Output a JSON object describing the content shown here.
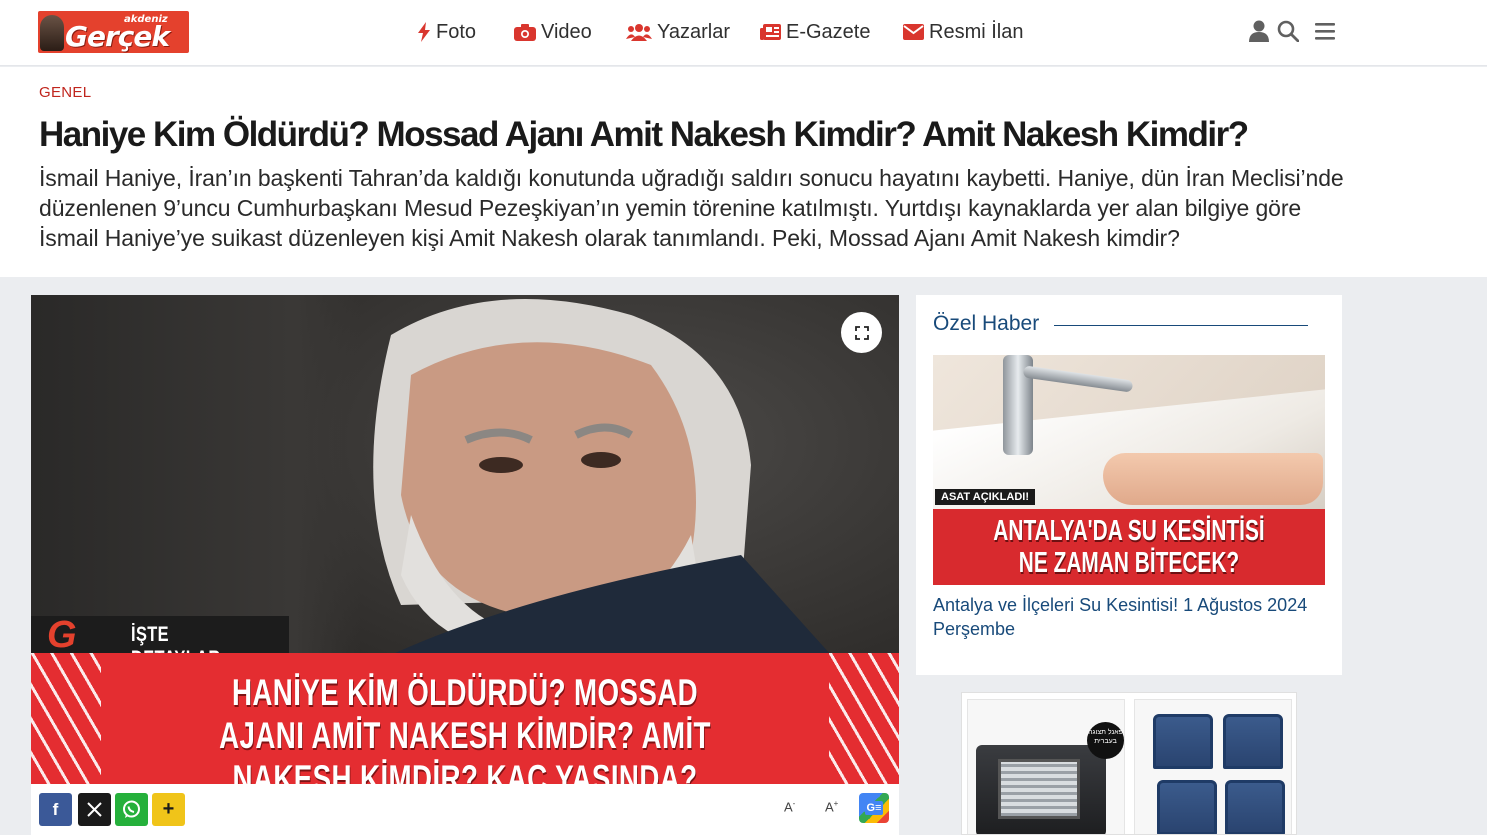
{
  "header": {
    "logo_small": "akdeniz",
    "logo_big": "Gerçek",
    "nav": [
      {
        "label": "Foto",
        "icon": "bolt-icon"
      },
      {
        "label": "Video",
        "icon": "camera-icon"
      },
      {
        "label": "Yazarlar",
        "icon": "users-icon"
      },
      {
        "label": "E-Gazete",
        "icon": "newspaper-icon"
      },
      {
        "label": "Resmi İlan",
        "icon": "envelope-icon"
      }
    ],
    "icons": [
      "user-icon",
      "search-icon",
      "menu-icon"
    ]
  },
  "article": {
    "category": "GENEL",
    "title": "Haniye Kim Öldürdü? Mossad Ajanı Amit Nakesh Kimdir? Amit Nakesh Kimdir?",
    "lead": "İsmail Haniye, İran’ın başkenti Tahran’da kaldığı konutunda uğradığı saldırı sonucu hayatını kaybetti. Haniye, dün İran Meclisi’nde düzenlenen 9’uncu Cumhurbaşkanı Mesud Pezeşkiyan’ın yemin törenine katılmıştı. Yurtdışı kaynaklarda yer alan bilgiye göre İsmail Haniye’ye suikast düzenleyen kişi Amit Nakesh olarak tanımlandı. Peki, Mossad Ajanı Amit Nakesh kimdir?"
  },
  "hero": {
    "badge_letter": "G",
    "badge_text": "İŞTE DETAYLAR",
    "banner_text": "HANİYE KİM ÖLDÜRDÜ? MOSSAD AJANI AMİT NAKESH KİMDİR? AMİT NAKESH KİMDİR? KAÇ YAŞINDA? NERELİ?"
  },
  "share": {
    "buttons": [
      {
        "name": "facebook-share-button",
        "glyph": "f",
        "color": "#3b5998"
      },
      {
        "name": "x-share-button",
        "glyph": "𝕏",
        "color": "#1a1a1a"
      },
      {
        "name": "whatsapp-share-button",
        "glyph": "",
        "color": "#25b03b"
      },
      {
        "name": "more-share-button",
        "glyph": "+",
        "color": "#f0c419"
      }
    ],
    "font_decrease": "A",
    "font_increase": "A",
    "font_decrease_sup": "-",
    "font_increase_sup": "+",
    "google_news": "G≡"
  },
  "sidebar": {
    "heading": "Özel Haber",
    "image_tag": "ASAT AÇIKLADI!",
    "image_headline": "ANTALYA'DA SU KESİNTİSİ NE ZAMAN BİTECEK?",
    "caption": "Antalya ve İlçeleri Su Kesintisi! 1 Ağustos 2024 Perşembe"
  },
  "ad": {
    "badge_text": "פאנל תצוגה בעברית"
  },
  "colors": {
    "brand_red": "#e4412d",
    "category_red": "#c0251d",
    "sidebar_blue": "#184a7a"
  }
}
